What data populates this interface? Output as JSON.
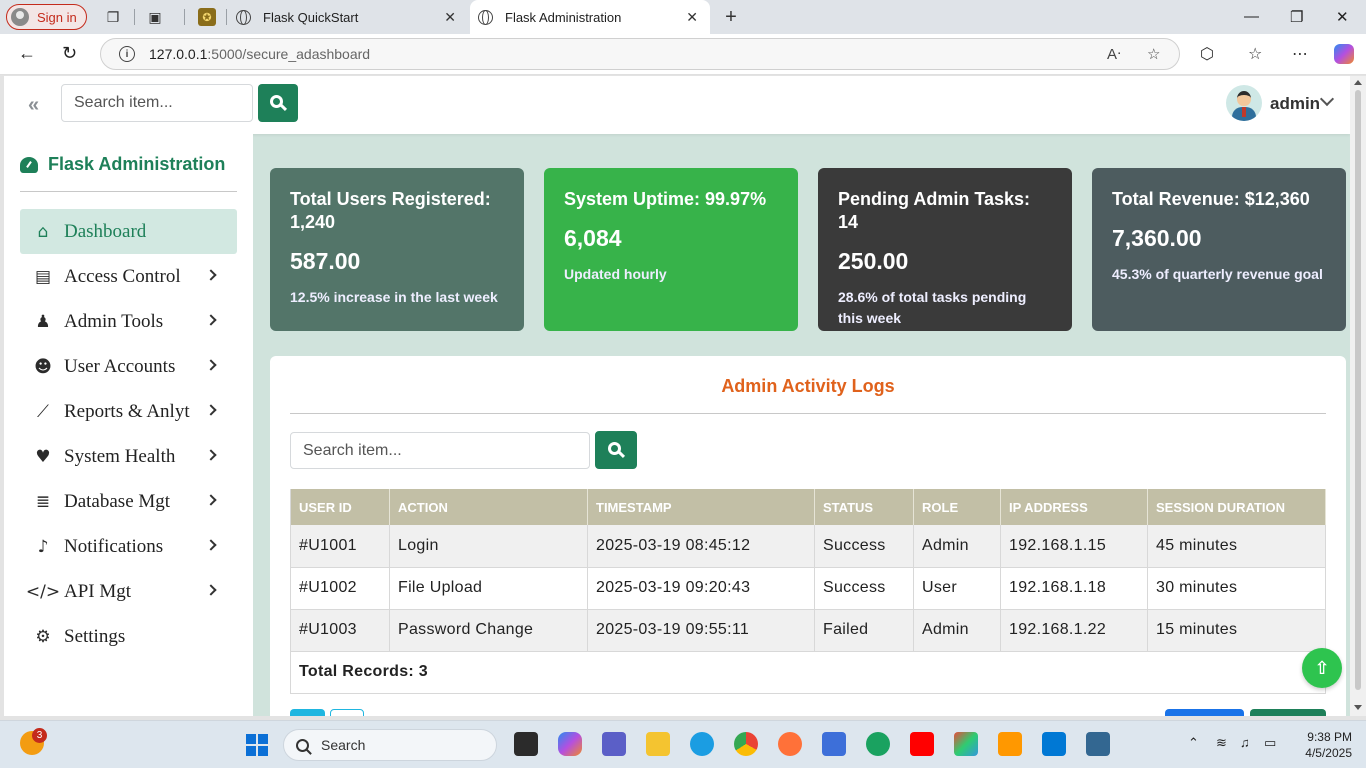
{
  "browser": {
    "signin_label": "Sign in",
    "tabs": [
      {
        "title": "Flask QuickStart"
      },
      {
        "title": "Flask Administration"
      }
    ],
    "url_host": "127.0.0.1",
    "url_path": ":5000/secure_adashboard"
  },
  "topbar": {
    "search_placeholder": "Search item...",
    "user_name": "admin"
  },
  "sidebar": {
    "brand": "Flask Administration",
    "items": [
      {
        "label": "Dashboard",
        "icon": "home-icon"
      },
      {
        "label": "Access Control",
        "icon": "document-icon"
      },
      {
        "label": "Admin Tools",
        "icon": "user-tie-icon"
      },
      {
        "label": "User Accounts",
        "icon": "users-icon"
      },
      {
        "label": "Reports & Anlyt",
        "icon": "chart-line-icon"
      },
      {
        "label": "System Health",
        "icon": "heartbeat-icon"
      },
      {
        "label": "Database Mgt",
        "icon": "database-icon"
      },
      {
        "label": "Notifications",
        "icon": "bell-icon"
      },
      {
        "label": "API Mgt",
        "icon": "code-icon"
      },
      {
        "label": "Settings",
        "icon": "user-gear-icon"
      }
    ]
  },
  "cards": [
    {
      "title": "Total Users Registered: 1,240",
      "value": "587.00",
      "sub": "12.5% increase in the last week",
      "color": "#537569"
    },
    {
      "title": "System Uptime: 99.97%",
      "value": "6,084",
      "sub": "Updated hourly",
      "color": "#37b34a"
    },
    {
      "title": "Pending Admin Tasks: 14",
      "value": "250.00",
      "sub": "28.6% of total tasks pending this week",
      "color": "#3a3a3a"
    },
    {
      "title": "Total Revenue: $12,360",
      "value": "7,360.00",
      "sub": "45.3% of quarterly revenue goal",
      "color": "#4d5c5f"
    }
  ],
  "logs": {
    "title": "Admin Activity Logs",
    "search_placeholder": "Search item...",
    "columns": [
      "USER ID",
      "ACTION",
      "TIMESTAMP",
      "STATUS",
      "ROLE",
      "IP ADDRESS",
      "SESSION DURATION"
    ],
    "rows": [
      [
        "#U1001",
        "Login",
        "2025-03-19 08:45:12",
        "Success",
        "Admin",
        "192.168.1.15",
        "45 minutes"
      ],
      [
        "#U1002",
        "File Upload",
        "2025-03-19 09:20:43",
        "Success",
        "User",
        "192.168.1.18",
        "30 minutes"
      ],
      [
        "#U1003",
        "Password Change",
        "2025-03-19 09:55:11",
        "Failed",
        "Admin",
        "192.168.1.22",
        "15 minutes"
      ]
    ],
    "total_label": "Total Records: 3"
  },
  "taskbar": {
    "search_label": "Search",
    "notification_count": "3",
    "time": "9:38 PM",
    "date": "4/5/2025"
  },
  "colors": {
    "accent": "#1e8059",
    "title_orange": "#e0621c",
    "header_khaki": "#c2bfa6"
  }
}
